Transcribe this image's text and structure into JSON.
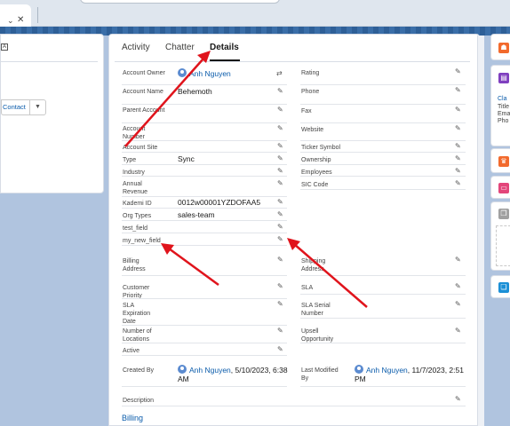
{
  "browser": {
    "tab_chevron": "⌄",
    "tab_close": "✕"
  },
  "left_panel": {
    "contact_button": "Contact",
    "contact_dropdown": "▼"
  },
  "tabs": [
    {
      "label": "Activity"
    },
    {
      "label": "Chatter"
    },
    {
      "label": "Details"
    }
  ],
  "details": {
    "account_owner_label": "Account Owner",
    "account_owner_value": "Anh Nguyen",
    "rating_label": "Rating",
    "account_name_label": "Account Name",
    "account_name_value": "Behemoth",
    "phone_label": "Phone",
    "parent_account_label": "Parent Account",
    "fax_label": "Fax",
    "account_number_label": "Account Number",
    "website_label": "Website",
    "account_site_label": "Account Site",
    "ticker_label": "Ticker Symbol",
    "type_label": "Type",
    "type_value": "Sync",
    "ownership_label": "Ownership",
    "industry_label": "Industry",
    "employees_label": "Employees",
    "annual_revenue_label": "Annual Revenue",
    "sic_label": "SIC Code",
    "kademi_label": "Kademi ID",
    "kademi_value": "0012w00001YZDOFAA5",
    "org_types_label": "Org Types",
    "org_types_value": "sales-team",
    "test_field_label": "test_field",
    "my_new_field_label": "my_new_field",
    "billing_address_label": "Billing Address",
    "shipping_address_label": "Shipping Address",
    "customer_priority_label": "Customer Priority",
    "sla_label": "SLA",
    "sla_expiration_label": "SLA Expiration Date",
    "sla_serial_label": "SLA Serial Number",
    "num_locations_label": "Number of Locations",
    "upsell_label": "Upsell Opportunity",
    "active_label": "Active",
    "created_by_label": "Created By",
    "created_by_name": "Anh Nguyen",
    "created_by_date_a": ", 5/10/2023, 6:38",
    "created_by_date_b": "AM",
    "modified_by_label_a": "Last Modified",
    "modified_by_label_b": "By",
    "modified_by_name": "Anh Nguyen",
    "modified_by_date_a": ", 11/7/2023, 2:51",
    "modified_by_date_b": "PM",
    "description_label": "Description",
    "billing_section": "Billing"
  },
  "right_rail": {
    "text_lines": [
      "Cla",
      "Title",
      "Ema",
      "Pho"
    ]
  },
  "colors": {
    "link": "#0b5cab",
    "arrow": "#e0141c",
    "band": "#2e5f97",
    "rail_orange": "#f26a2d",
    "rail_purple": "#7f3fbf",
    "rail_pink": "#e3467a",
    "rail_blue": "#1b8fd6"
  }
}
